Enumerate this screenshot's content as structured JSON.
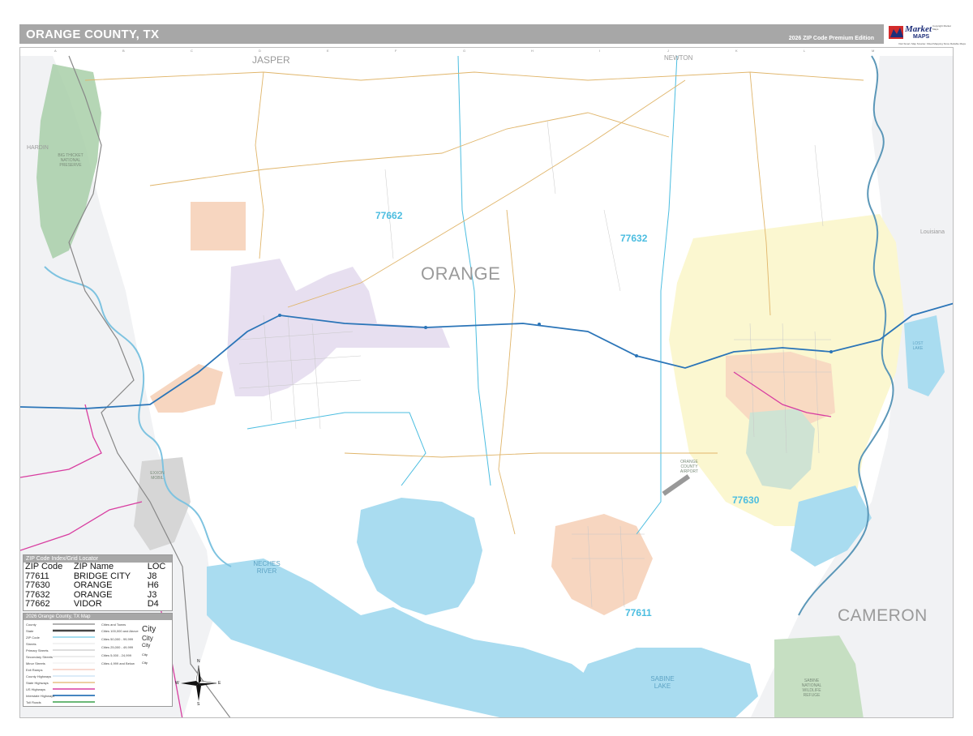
{
  "header": {
    "title": "ORANGE COUNTY, TX",
    "edition": "2026 ZIP Code Premium Edition"
  },
  "brand": {
    "logo_text": "Market",
    "logo_sub": "MAPS",
    "tagline": "Visit Smart. Map Smarter. Fitted Mapping Since Reliable Maps",
    "fine_print": "Copyright Market Maps"
  },
  "map": {
    "county_name": "ORANGE",
    "adjacent": [
      {
        "name": "JASPER"
      },
      {
        "name": "NEWTON"
      },
      {
        "name": "HARDIN"
      },
      {
        "name": "CAMERON"
      },
      {
        "name": "Louisiana"
      }
    ],
    "zip_labels": [
      "77662",
      "77632",
      "77630",
      "77611"
    ],
    "water": [
      {
        "name": "NECHES RIVER"
      },
      {
        "name": "SABINE LAKE"
      },
      {
        "name": "LOST LAKE"
      }
    ],
    "parks": [
      {
        "name": "BIG THICKET NATIONAL PRESERVE"
      },
      {
        "name": "SABINE NATIONAL WILDLIFE REFUGE"
      },
      {
        "name": "EXXON MOBIL"
      },
      {
        "name": "ORANGE COUNTY AIRPORT"
      }
    ],
    "grid_letters": [
      "A",
      "B",
      "C",
      "D",
      "E",
      "F",
      "G",
      "H",
      "I",
      "J",
      "K",
      "L",
      "M"
    ],
    "colors": {
      "zip_77662": "#e7dff0",
      "zip_77632": "#fbf7d0",
      "zip_77630": "#cfe3d3",
      "zip_77611": "#f7d6c0",
      "vidor_peach": "#f7d6c0",
      "water": "#a9dcf0",
      "interstate": "#2b75b8",
      "us_highway": "#d83da0",
      "state_highway": "#e0b56a",
      "park_green": "#a8cfa8"
    }
  },
  "zip_index": {
    "title": "ZIP Code Index/Grid Locator",
    "headers": [
      "ZIP Code",
      "ZIP Name",
      "LOC"
    ],
    "rows": [
      [
        "77611",
        "BRIDGE CITY",
        "J8"
      ],
      [
        "77630",
        "ORANGE",
        "H6"
      ],
      [
        "77632",
        "ORANGE",
        "J3"
      ],
      [
        "77662",
        "VIDOR",
        "D4"
      ]
    ]
  },
  "legend": {
    "title": "2026 Orange County, TX Map",
    "items": [
      "County",
      "State",
      "ZIP Code",
      "Streets",
      "Primary Streets",
      "Secondary Streets",
      "Minor Streets",
      "Exit Ramps",
      "County Highways",
      "State Highways",
      "US Highways",
      "Interstate Highways",
      "Toll Roads"
    ],
    "city_header": "Cities and Towns",
    "cities": [
      {
        "range": "Cities 100,000 and Above",
        "sample": "City"
      },
      {
        "range": "Cities 50,000 - 99,999",
        "sample": "City"
      },
      {
        "range": "Cities 25,000 - 49,999",
        "sample": "City"
      },
      {
        "range": "Cities 5,000 - 24,999",
        "sample": "City"
      },
      {
        "range": "Cities 4,999 and Below",
        "sample": "City"
      }
    ]
  },
  "compass": {
    "n": "N",
    "s": "S",
    "e": "E",
    "w": "W"
  }
}
